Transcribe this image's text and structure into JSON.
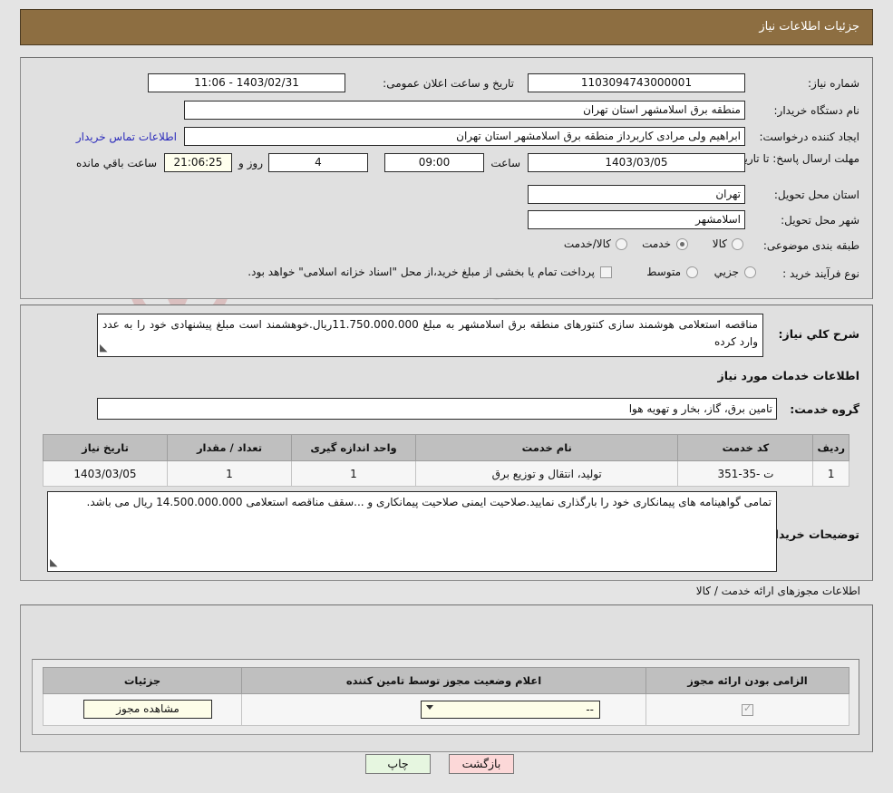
{
  "header": {
    "title": "جزئیات اطلاعات نیاز"
  },
  "watermark": {
    "text": "AriaTender.net"
  },
  "main": {
    "need_number": {
      "label": "شماره نیاز:",
      "value": "1103094743000001"
    },
    "announce": {
      "label": "تاریخ و ساعت اعلان عمومی:",
      "value": "1403/02/31 - 11:06"
    },
    "buyer_org": {
      "label": "نام دستگاه خریدار:",
      "value": "منطقه برق اسلامشهر استان تهران"
    },
    "creator": {
      "label": "ایجاد کننده درخواست:",
      "value": "ابراهیم ولی مرادی کاربرداز منطقه برق اسلامشهر استان تهران"
    },
    "contact_link": "اطلاعات تماس خریدار",
    "deadline": {
      "label": "مهلت ارسال پاسخ: تا تاریخ:",
      "date": "1403/03/05",
      "time_label": "ساعت",
      "time": "09:00",
      "days": "4",
      "days_label": "روز و",
      "countdown": "21:06:25",
      "countdown_label": "ساعت باقي مانده"
    },
    "province": {
      "label": "استان محل تحویل:",
      "value": "تهران"
    },
    "city": {
      "label": "شهر محل تحویل:",
      "value": "اسلامشهر"
    },
    "category": {
      "label": "طبقه بندی موضوعی:",
      "options": [
        "کالا",
        "خدمت",
        "کالا/خدمت"
      ],
      "selected": "خدمت"
    },
    "process": {
      "label": "نوع فرآیند خرید :",
      "options": [
        "جزیي",
        "متوسط"
      ],
      "selected": "",
      "note_checked": false,
      "note": "پرداخت تمام یا بخشی از مبلغ خرید،از محل \"اسناد خزانه اسلامی\" خواهد بود."
    }
  },
  "detail": {
    "summary": {
      "label": "شرح کلي نیاز:",
      "value": "مناقصه استعلامی هوشمند سازی کنتورهای منطقه برق اسلامشهر به مبلغ 11.750.000.000ریال.خوهشمند است مبلغ پیشنهادی خود را به عدد وارد کرده"
    },
    "section_title": "اطلاعات خدمات مورد نیاز",
    "service_group": {
      "label": "گروه خدمت:",
      "value": "تامین برق، گاز، بخار و تهویه هوا"
    },
    "table": {
      "columns": [
        "ردیف",
        "کد خدمت",
        "نام خدمت",
        "واحد اندازه گیری",
        "تعداد / مقدار",
        "تاریخ نیاز"
      ],
      "rows": [
        [
          "1",
          "ت -35-351",
          "تولید، انتقال و توزیع برق",
          "1",
          "1",
          "1403/03/05"
        ]
      ]
    },
    "buyer_notes": {
      "label": "توضیحات خریدار:",
      "value": "تمامی گواهینامه های پیمانکاری خود را بارگذاری نمایید.صلاحیت ایمنی صلاحیت پیمانکاری و ...سقف مناقصه استعلامی 14.500.000.000 ریال می باشد."
    }
  },
  "permits": {
    "section_title": "اطلاعات مجوزهای ارائه خدمت / کالا",
    "columns": [
      "الزامی بودن ارائه مجوز",
      "اعلام وضعیت مجوز توسط تامین کننده",
      "جزئیات"
    ],
    "rows": [
      {
        "required": true,
        "status": "--",
        "details_button": "مشاهده مجوز"
      }
    ]
  },
  "footer": {
    "back_button": "بازگشت",
    "print_button": "چاپ"
  },
  "colors": {
    "header_bar": "#8d6e41",
    "page_bg": "#e4e4e4",
    "panel_bg": "#e0e0e0",
    "link": "#2b2bbb",
    "back_button": "#fcd8d8",
    "print_button": "#e6f6e0",
    "table_header": "#bfbfbf"
  }
}
